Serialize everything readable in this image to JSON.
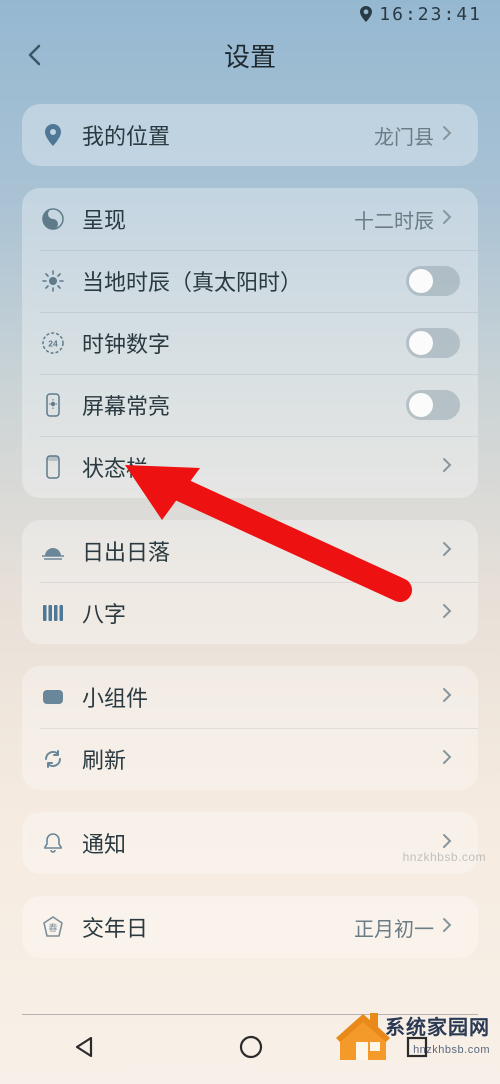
{
  "status": {
    "time": "16:23:41"
  },
  "header": {
    "title": "设置"
  },
  "section_location": {
    "my_location_label": "我的位置",
    "my_location_value": "龙门县"
  },
  "section_display": {
    "presentation_label": "呈现",
    "presentation_value": "十二时辰",
    "local_time_label": "当地时辰（真太阳时）",
    "clock_digits_label": "时钟数字",
    "keep_screen_on_label": "屏幕常亮",
    "status_bar_label": "状态栏"
  },
  "section_sun": {
    "sunrise_sunset_label": "日出日落",
    "bazi_label": "八字"
  },
  "section_widget": {
    "widget_label": "小组件",
    "refresh_label": "刷新"
  },
  "section_notify": {
    "notification_label": "通知"
  },
  "section_year": {
    "cross_year_label": "交年日",
    "cross_year_value": "正月初一"
  },
  "branding": {
    "cn": "系统家园网",
    "en": "hnzkhbsb.com"
  },
  "watermark": "hnzkhbsb.com"
}
